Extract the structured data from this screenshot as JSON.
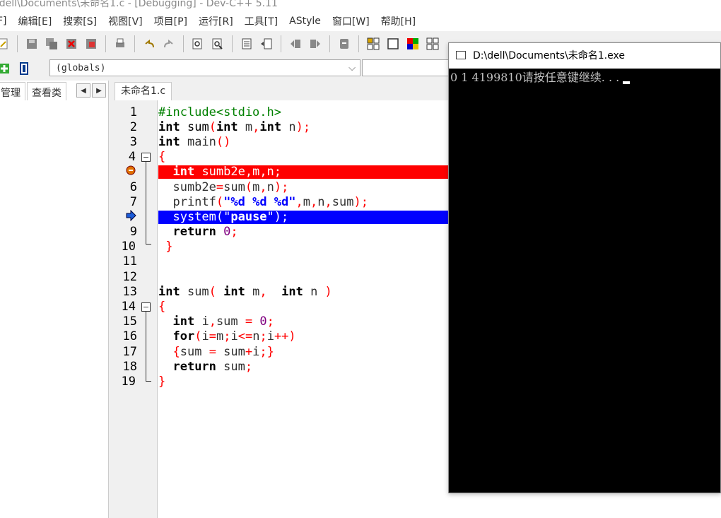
{
  "window": {
    "title": "\\dell\\Documents\\未命名1.c - [Debugging] - Dev-C++ 5.11"
  },
  "menu": [
    "F]",
    "编辑[E]",
    "搜索[S]",
    "视图[V]",
    "项目[P]",
    "运行[R]",
    "工具[T]",
    "AStyle",
    "窗口[W]",
    "帮助[H]"
  ],
  "scope": {
    "value": "(globals)"
  },
  "left_tabs": [
    "管理",
    "查看类"
  ],
  "editor": {
    "tab_label": "未命名1.c",
    "line_numbers": [
      "1",
      "2",
      "3",
      "4",
      "5",
      "6",
      "7",
      "8",
      "9",
      "10",
      "11",
      "12",
      "13",
      "14",
      "15",
      "16",
      "17",
      "18",
      "19"
    ]
  },
  "console": {
    "title": "D:\\dell\\Documents\\未命名1.exe",
    "output": "0 1 4199810请按任意键继续. . . "
  },
  "colors": {
    "breakpoint": "#ff0000",
    "exec_line": "#0000ff"
  }
}
